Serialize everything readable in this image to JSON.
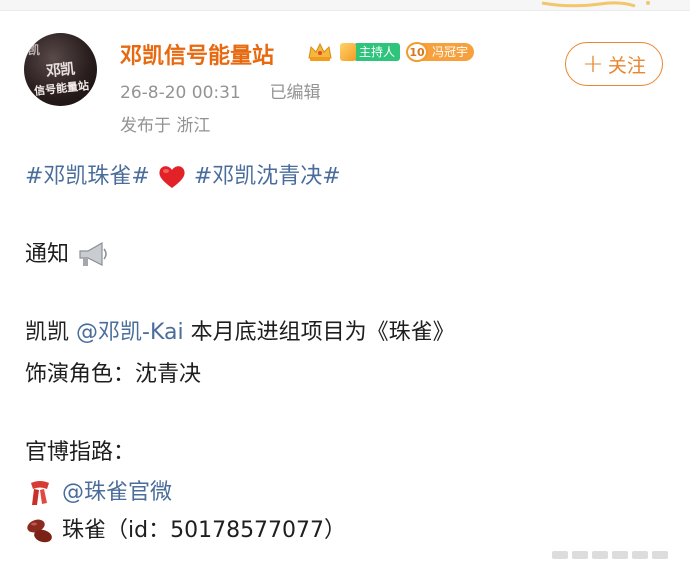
{
  "post": {
    "username": "邓凯信号能量站",
    "host_badge": "主持人",
    "fan_badge": {
      "level": "10",
      "name": "冯冠宇"
    },
    "timestamp": "26-8-20 00:31",
    "edited": "已编辑",
    "location": "发布于 浙江",
    "follow_label": "关注",
    "content": {
      "hashtag1": "#邓凯珠雀#",
      "hashtag2": "#邓凯沈青决#",
      "notice": "通知",
      "line3_prefix": "凯凯 ",
      "mention1": "@邓凯-Kai",
      "line3_suffix": " 本月底进组项目为《珠雀》",
      "line4": "饰演角色：沈青决",
      "line5": "官博指路：",
      "mention2": "@珠雀官微",
      "line7": "珠雀（id：50178577077）"
    }
  },
  "avatar_text": {
    "top": "凯",
    "mid": "邓凯",
    "bottom": "信号能量站"
  },
  "icons": [
    "crown-icon",
    "heart-icon",
    "megaphone-icon",
    "scarf-icon",
    "beans-icon"
  ],
  "colors": {
    "username": "#e86a10",
    "link": "#4a6d9b",
    "follow": "#e8862e",
    "meta": "#939393"
  }
}
